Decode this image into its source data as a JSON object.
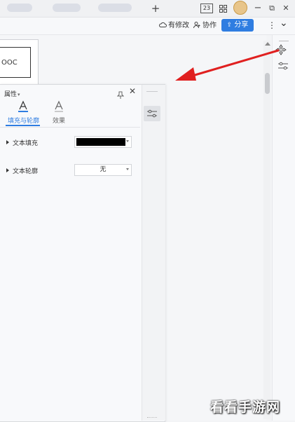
{
  "titlebar": {
    "add_tab": "+",
    "badge": "23",
    "minimize": "−",
    "restore": "⧉",
    "close": "✕"
  },
  "toolbar": {
    "unmodified": "有修改",
    "collab": "协作",
    "share": "分享",
    "more": "⋮",
    "expand": "⌄"
  },
  "document": {
    "page_text": "OOC"
  },
  "panel": {
    "title": "属性",
    "title_caret": "▾",
    "tabs": [
      {
        "label": "填充与轮廓"
      },
      {
        "label": "效果"
      }
    ],
    "rows": [
      {
        "label": "文本填充",
        "value_color": "#000000"
      },
      {
        "label": "文本轮廓",
        "value": "无"
      }
    ]
  },
  "accent_color": "#2f7de1",
  "arrow_color": "#e02020",
  "watermark": "看看手游网"
}
